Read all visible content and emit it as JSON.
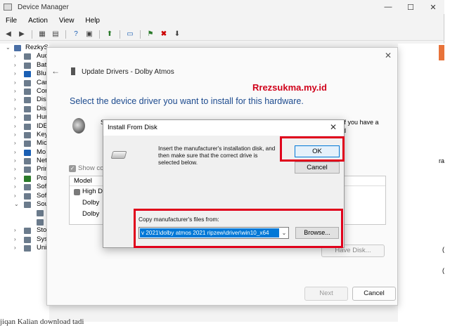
{
  "window": {
    "title": "Device Manager",
    "minimize": "—",
    "maximize": "☐",
    "close": "✕"
  },
  "menu": [
    "File",
    "Action",
    "View",
    "Help"
  ],
  "tree": {
    "root": "RezkyS",
    "categories": [
      "Aud",
      "Batt",
      "Blue",
      "Can",
      "Con",
      "Disk",
      "Disp",
      "Hum",
      "IDE",
      "Key",
      "Mic",
      "Mo",
      "Net",
      "Prin",
      "Pro",
      "Soft",
      "Soft",
      "Sou",
      "",
      "",
      "Sto",
      "Syst",
      "Univ"
    ]
  },
  "update_dialog": {
    "title": "Update Drivers - Dolby Atmos",
    "heading": "Select the device driver you want to install for this hardware.",
    "watermark": "Rrezsukma.my.id",
    "s_frag": "S",
    "have_frag_line1": "If you have a",
    "have_frag_line2": "d",
    "show_compatible": "Show co",
    "model_header": "Model",
    "model_item_1": "High D",
    "model_item_2": "Dolby",
    "model_item_3": "Dolby",
    "have_disk": "Have Disk...",
    "next": "Next",
    "cancel": "Cancel",
    "close": "✕",
    "back": "←"
  },
  "install_dialog": {
    "title": "Install From Disk",
    "close": "✕",
    "instructions": "Insert the manufacturer's installation disk, and then make sure that the correct drive is selected below.",
    "ok": "OK",
    "cancel": "Cancel",
    "copy_label": "Copy manufacturer's files from:",
    "path_value": "v 2021\\dolby atmos 2021 ripzew\\driver\\win10_x64",
    "browse": "Browse..."
  },
  "right_strip": {
    "ra": "ra",
    "paren1": "(",
    "paren2": "("
  },
  "bottom_text": "jiqan Kalian download tadi",
  "colors": {
    "heading": "#1c4a8e",
    "watermark": "#d0021b",
    "annotation": "#e0001b",
    "selection": "#0078d7"
  }
}
